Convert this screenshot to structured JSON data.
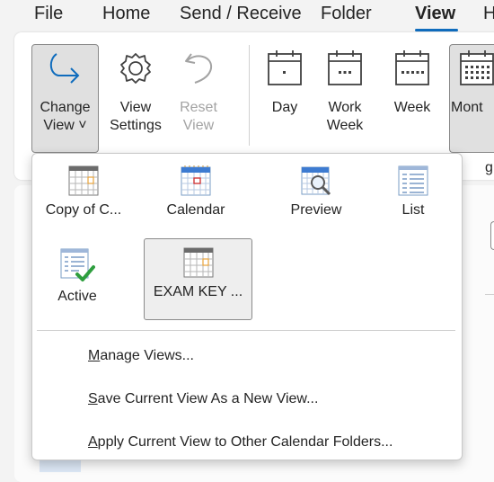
{
  "ribbon_tabs": [
    "File",
    "Home",
    "Send / Receive",
    "Folder",
    "View",
    "H"
  ],
  "ribbon_buttons": {
    "change_view": [
      "Change",
      "View ˅"
    ],
    "view_settings": [
      "View",
      "Settings"
    ],
    "reset_view": [
      "Reset",
      "View"
    ],
    "day": "Day",
    "work_week": [
      "Work",
      "Week"
    ],
    "week": "Week",
    "month": "Mont"
  },
  "ribbon_edge": {
    "group_fragment": "g"
  },
  "views": [
    {
      "label": "Copy of C...",
      "icon": "calendar-grid-icon"
    },
    {
      "label": "Calendar",
      "icon": "calendar-blue-icon"
    },
    {
      "label": "Preview",
      "icon": "calendar-preview-icon"
    },
    {
      "label": "List",
      "icon": "list-view-icon"
    },
    {
      "label": "Active",
      "icon": "active-list-icon"
    },
    {
      "label": "EXAM KEY ...",
      "icon": "calendar-grid-icon",
      "selected": true
    }
  ],
  "menu": [
    {
      "mnemonic": "M",
      "rest": "anage Views..."
    },
    {
      "mnemonic": "S",
      "rest": "ave Current View As a New View..."
    },
    {
      "mnemonic": "A",
      "rest": "pply Current View to Other Calendar Folders..."
    }
  ],
  "colors": {
    "accent": "#0f6cbd",
    "check": "#2e9e3e"
  }
}
